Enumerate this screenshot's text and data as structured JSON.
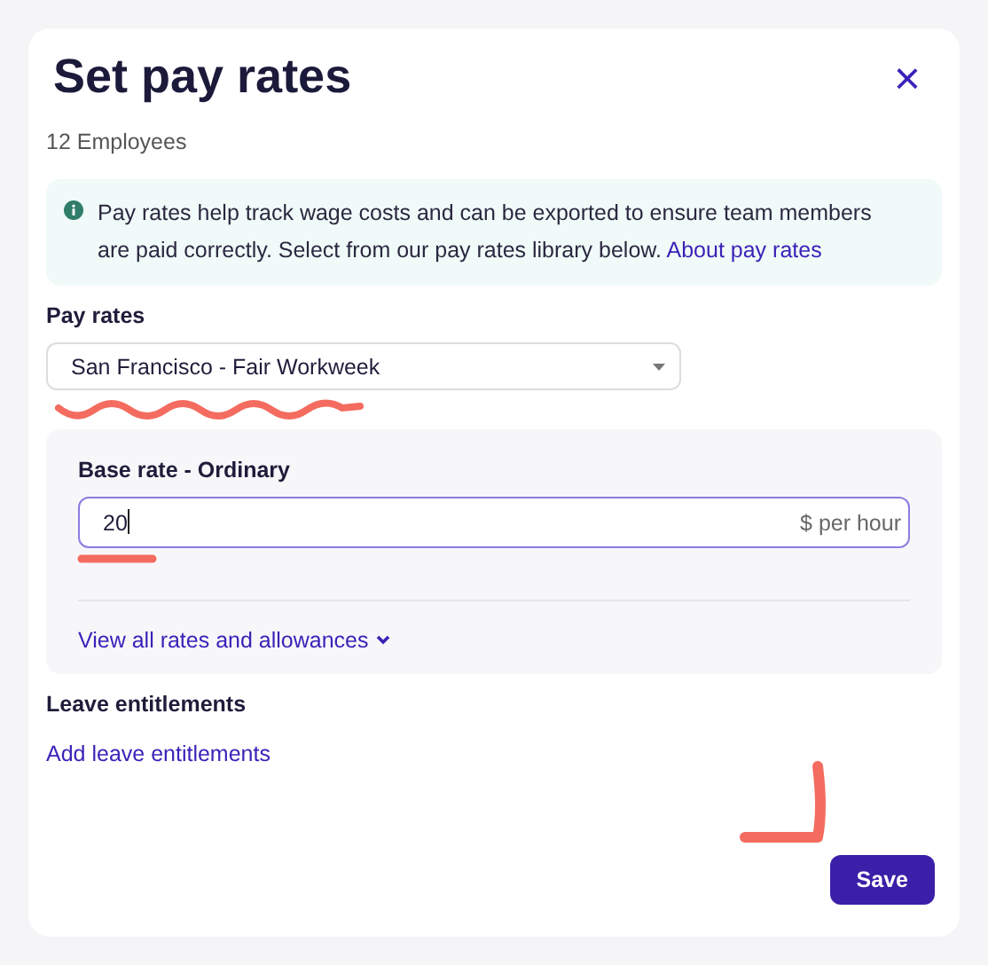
{
  "dialog": {
    "title": "Set pay rates",
    "subtitle": "12 Employees",
    "close": "×"
  },
  "info": {
    "text": "Pay rates help track wage costs and can be exported to ensure team members are paid correctly. Select from our pay rates library below.",
    "link": "About pay rates"
  },
  "pay_rates": {
    "label": "Pay rates",
    "value": "San Francisco - Fair Workweek"
  },
  "base_rate": {
    "label": "Base rate - Ordinary",
    "value": "20",
    "suffix": "$ per hour",
    "focused": true,
    "link": "View all rates and allowances"
  },
  "leave": {
    "label": "Leave entitlements",
    "link": "Add leave entitlements"
  },
  "buttons": [
    "Save"
  ]
}
